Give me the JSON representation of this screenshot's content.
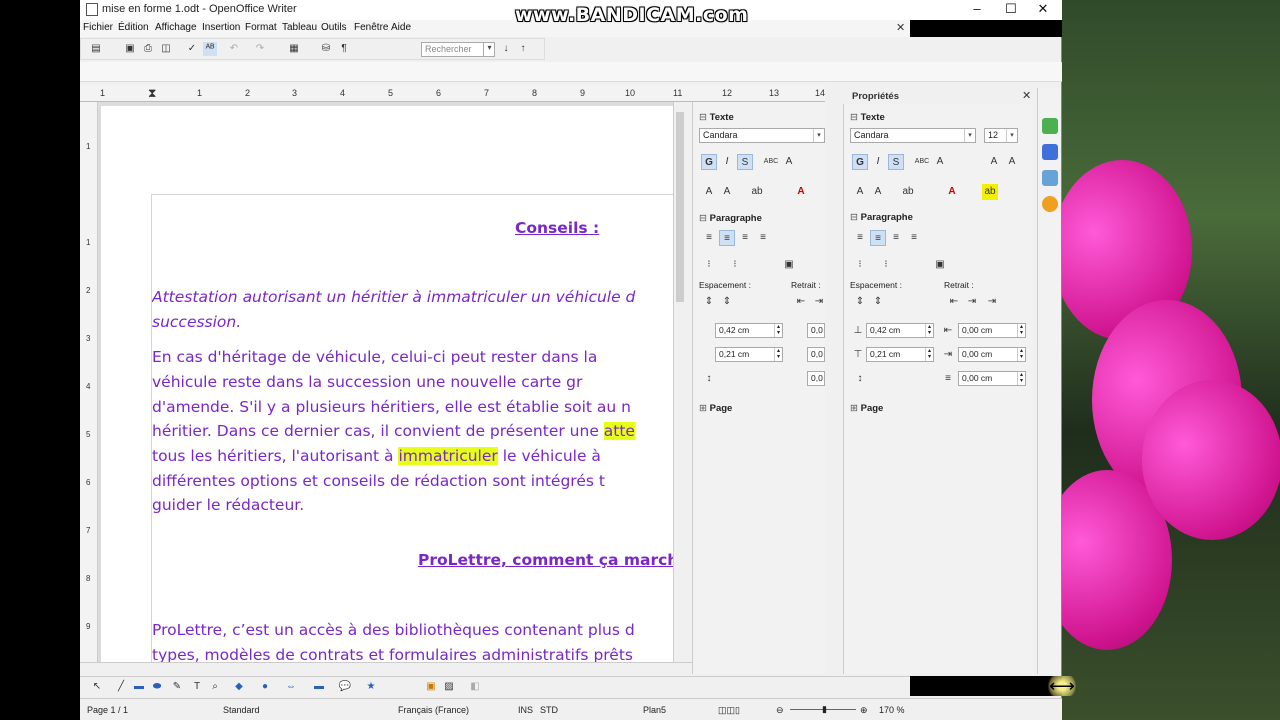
{
  "window": {
    "title": "mise en forme 1.odt - OpenOffice Writer",
    "minimize": "–",
    "maximize": "☐",
    "close": "✕",
    "doc_close": "✕"
  },
  "watermark": "www.BANDICAM.com",
  "menu": [
    "Fichier",
    "Édition",
    "Affichage",
    "Insertion",
    "Format",
    "Tableau",
    "Outils",
    "Fenêtre",
    "Aide"
  ],
  "toolbar": {
    "search_placeholder": "Rechercher"
  },
  "ruler": {
    "numbers": [
      "1",
      "1",
      "2",
      "3",
      "4",
      "5",
      "6",
      "7",
      "8",
      "9",
      "10",
      "11",
      "12",
      "13",
      "14"
    ],
    "vertical_numbers": [
      "1",
      "1",
      "2",
      "3",
      "4",
      "5",
      "6",
      "7",
      "8",
      "9"
    ]
  },
  "document": {
    "heading1": "Conseils :",
    "italic_line1": "Attestation autorisant un héritier à immatriculer un véhicule d",
    "italic_line2": "succession.",
    "para_lines": [
      "En cas d'héritage de véhicule, celui-ci peut rester dans la",
      "véhicule reste dans la succession une nouvelle carte gr",
      "d'amende. S'il y a plusieurs héritiers, elle est établie soit au n"
    ],
    "line4_pre": "héritier. Dans ce dernier cas, il convient de présenter une ",
    "line4_hl": "atte",
    "line5_pre": "tous les héritiers, l'autorisant à ",
    "line5_hl": "immatriculer",
    "line5_post": " le véhicule à",
    "line6": "différentes options et conseils de rédaction sont intégrés t",
    "line7": "guider le rédacteur.",
    "heading2": "ProLettre, comment ça march",
    "last_lines": [
      "ProLettre, c’est un accès à des bibliothèques contenant plus d",
      "types, modèles de contrats et formulaires administratifs prêts"
    ]
  },
  "properties": {
    "title": "Propriétés",
    "close": "✕",
    "texte": "Texte",
    "paragraphe": "Paragraphe",
    "page": "Page",
    "espacement": "Espacement :",
    "retrait": "Retrait :",
    "left_panel": {
      "font": "Candara",
      "spacing_above": "0,42 cm",
      "spacing_below": "0,21 cm",
      "indent_before": "0,0",
      "indent_after": "0,0",
      "indent_first": "0,0"
    },
    "right_panel": {
      "font": "Candara",
      "size": "12",
      "spacing_above": "0,42 cm",
      "spacing_below": "0,21 cm",
      "indent_before": "0,00 cm",
      "indent_after": "0,00 cm",
      "indent_first": "0,00 cm"
    },
    "bold": "G",
    "italic": "I",
    "shadow": "S",
    "strike": "ABC"
  },
  "status": {
    "page": "Page 1 / 1",
    "style": "Standard",
    "language": "Français (France)",
    "ins": "INS",
    "std": "STD",
    "plan": "Plan5",
    "zoom": "170 %"
  },
  "colors": {
    "doc_text": "#7a27c9",
    "highlight": "#e6ff1a"
  }
}
